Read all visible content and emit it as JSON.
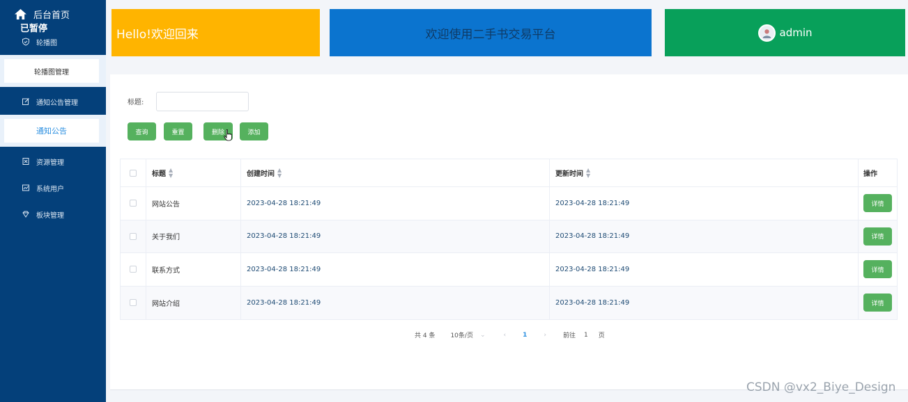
{
  "sidebar": {
    "home_label": "后台首页",
    "paused_label": "已暂停",
    "menu": [
      {
        "label": "轮播图",
        "icon": "shield-icon"
      },
      {
        "label": "通知公告管理",
        "icon": "edit-icon"
      },
      {
        "label": "资源管理",
        "icon": "resource-icon"
      },
      {
        "label": "系统用户",
        "icon": "chart-icon"
      },
      {
        "label": "板块管理",
        "icon": "diamond-icon"
      }
    ],
    "submenu": {
      "carousel_manage": "轮播图管理",
      "notice": "通知公告"
    }
  },
  "header": {
    "hello": "Hello!欢迎回来",
    "welcome": "欢迎使用二手书交易平台",
    "user": "admin"
  },
  "filter": {
    "title_label": "标题:",
    "title_value": "",
    "buttons": {
      "query": "查询",
      "reset": "重置",
      "delete": "删除",
      "add": "添加"
    }
  },
  "table": {
    "columns": {
      "title": "标题",
      "created": "创建时间",
      "updated": "更新时间",
      "op": "操作"
    },
    "rows": [
      {
        "title": "网站公告",
        "created": "2023-04-28 18:21:49",
        "updated": "2023-04-28 18:21:49",
        "action": "详情"
      },
      {
        "title": "关于我们",
        "created": "2023-04-28 18:21:49",
        "updated": "2023-04-28 18:21:49",
        "action": "详情"
      },
      {
        "title": "联系方式",
        "created": "2023-04-28 18:21:49",
        "updated": "2023-04-28 18:21:49",
        "action": "详情"
      },
      {
        "title": "网站介绍",
        "created": "2023-04-28 18:21:49",
        "updated": "2023-04-28 18:21:49",
        "action": "详情"
      }
    ]
  },
  "pagination": {
    "total": "共 4 条",
    "page_size": "10条/页",
    "current_page": "1",
    "goto_label": "前往",
    "goto_value": "1",
    "page_suffix": "页"
  },
  "watermark": "CSDN @vx2_Biye_Design",
  "colors": {
    "sidebar": "#04407a",
    "hello_card": "#ffb400",
    "welcome_card": "#0b74cf",
    "admin_card": "#08a05a",
    "button_green": "#55b15e"
  }
}
